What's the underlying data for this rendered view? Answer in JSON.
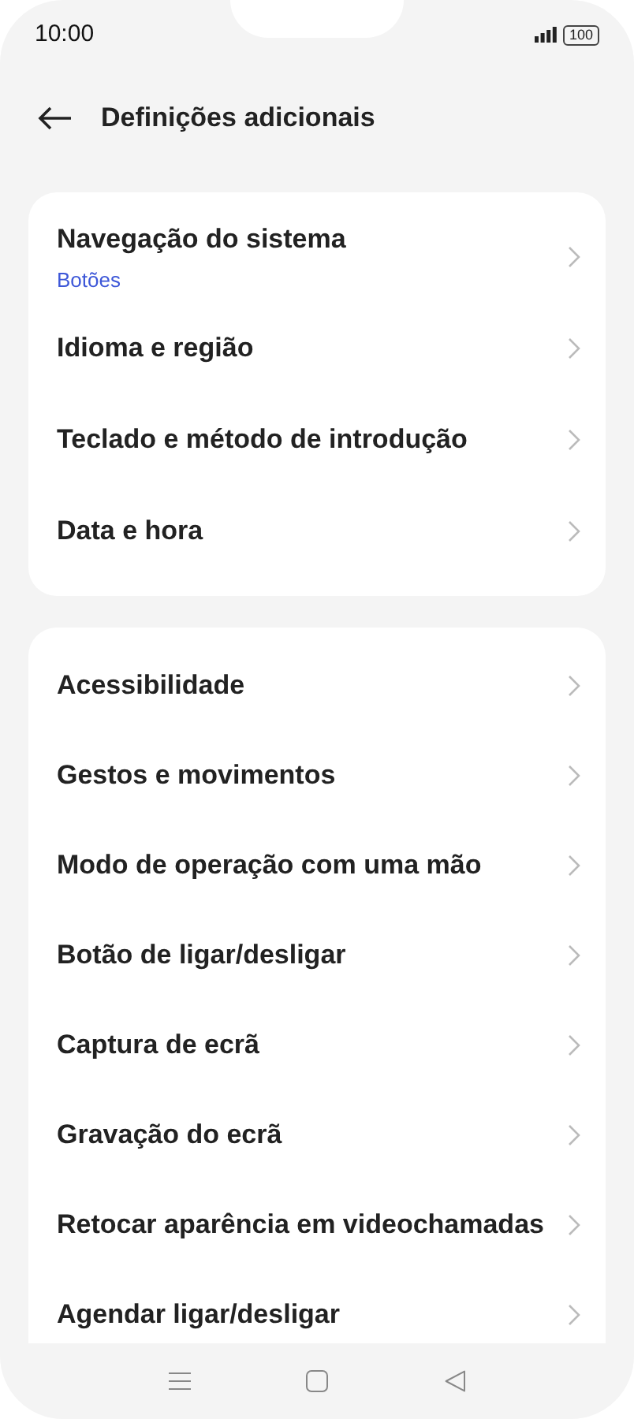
{
  "status_bar": {
    "time": "10:00",
    "battery": "100"
  },
  "header": {
    "title": "Definições adicionais"
  },
  "groups": [
    {
      "items": [
        {
          "title": "Navegação do sistema",
          "subtitle": "Botões"
        },
        {
          "title": "Idioma e região"
        },
        {
          "title": "Teclado e método de introdução"
        },
        {
          "title": "Data e hora"
        }
      ]
    },
    {
      "items": [
        {
          "title": "Acessibilidade"
        },
        {
          "title": "Gestos e movimentos"
        },
        {
          "title": "Modo de operação com uma mão"
        },
        {
          "title": "Botão de ligar/desligar"
        },
        {
          "title": "Captura de ecrã"
        },
        {
          "title": "Gravação do ecrã"
        },
        {
          "title": "Retocar aparência em videochamadas"
        },
        {
          "title": "Agendar ligar/desligar"
        }
      ]
    }
  ]
}
